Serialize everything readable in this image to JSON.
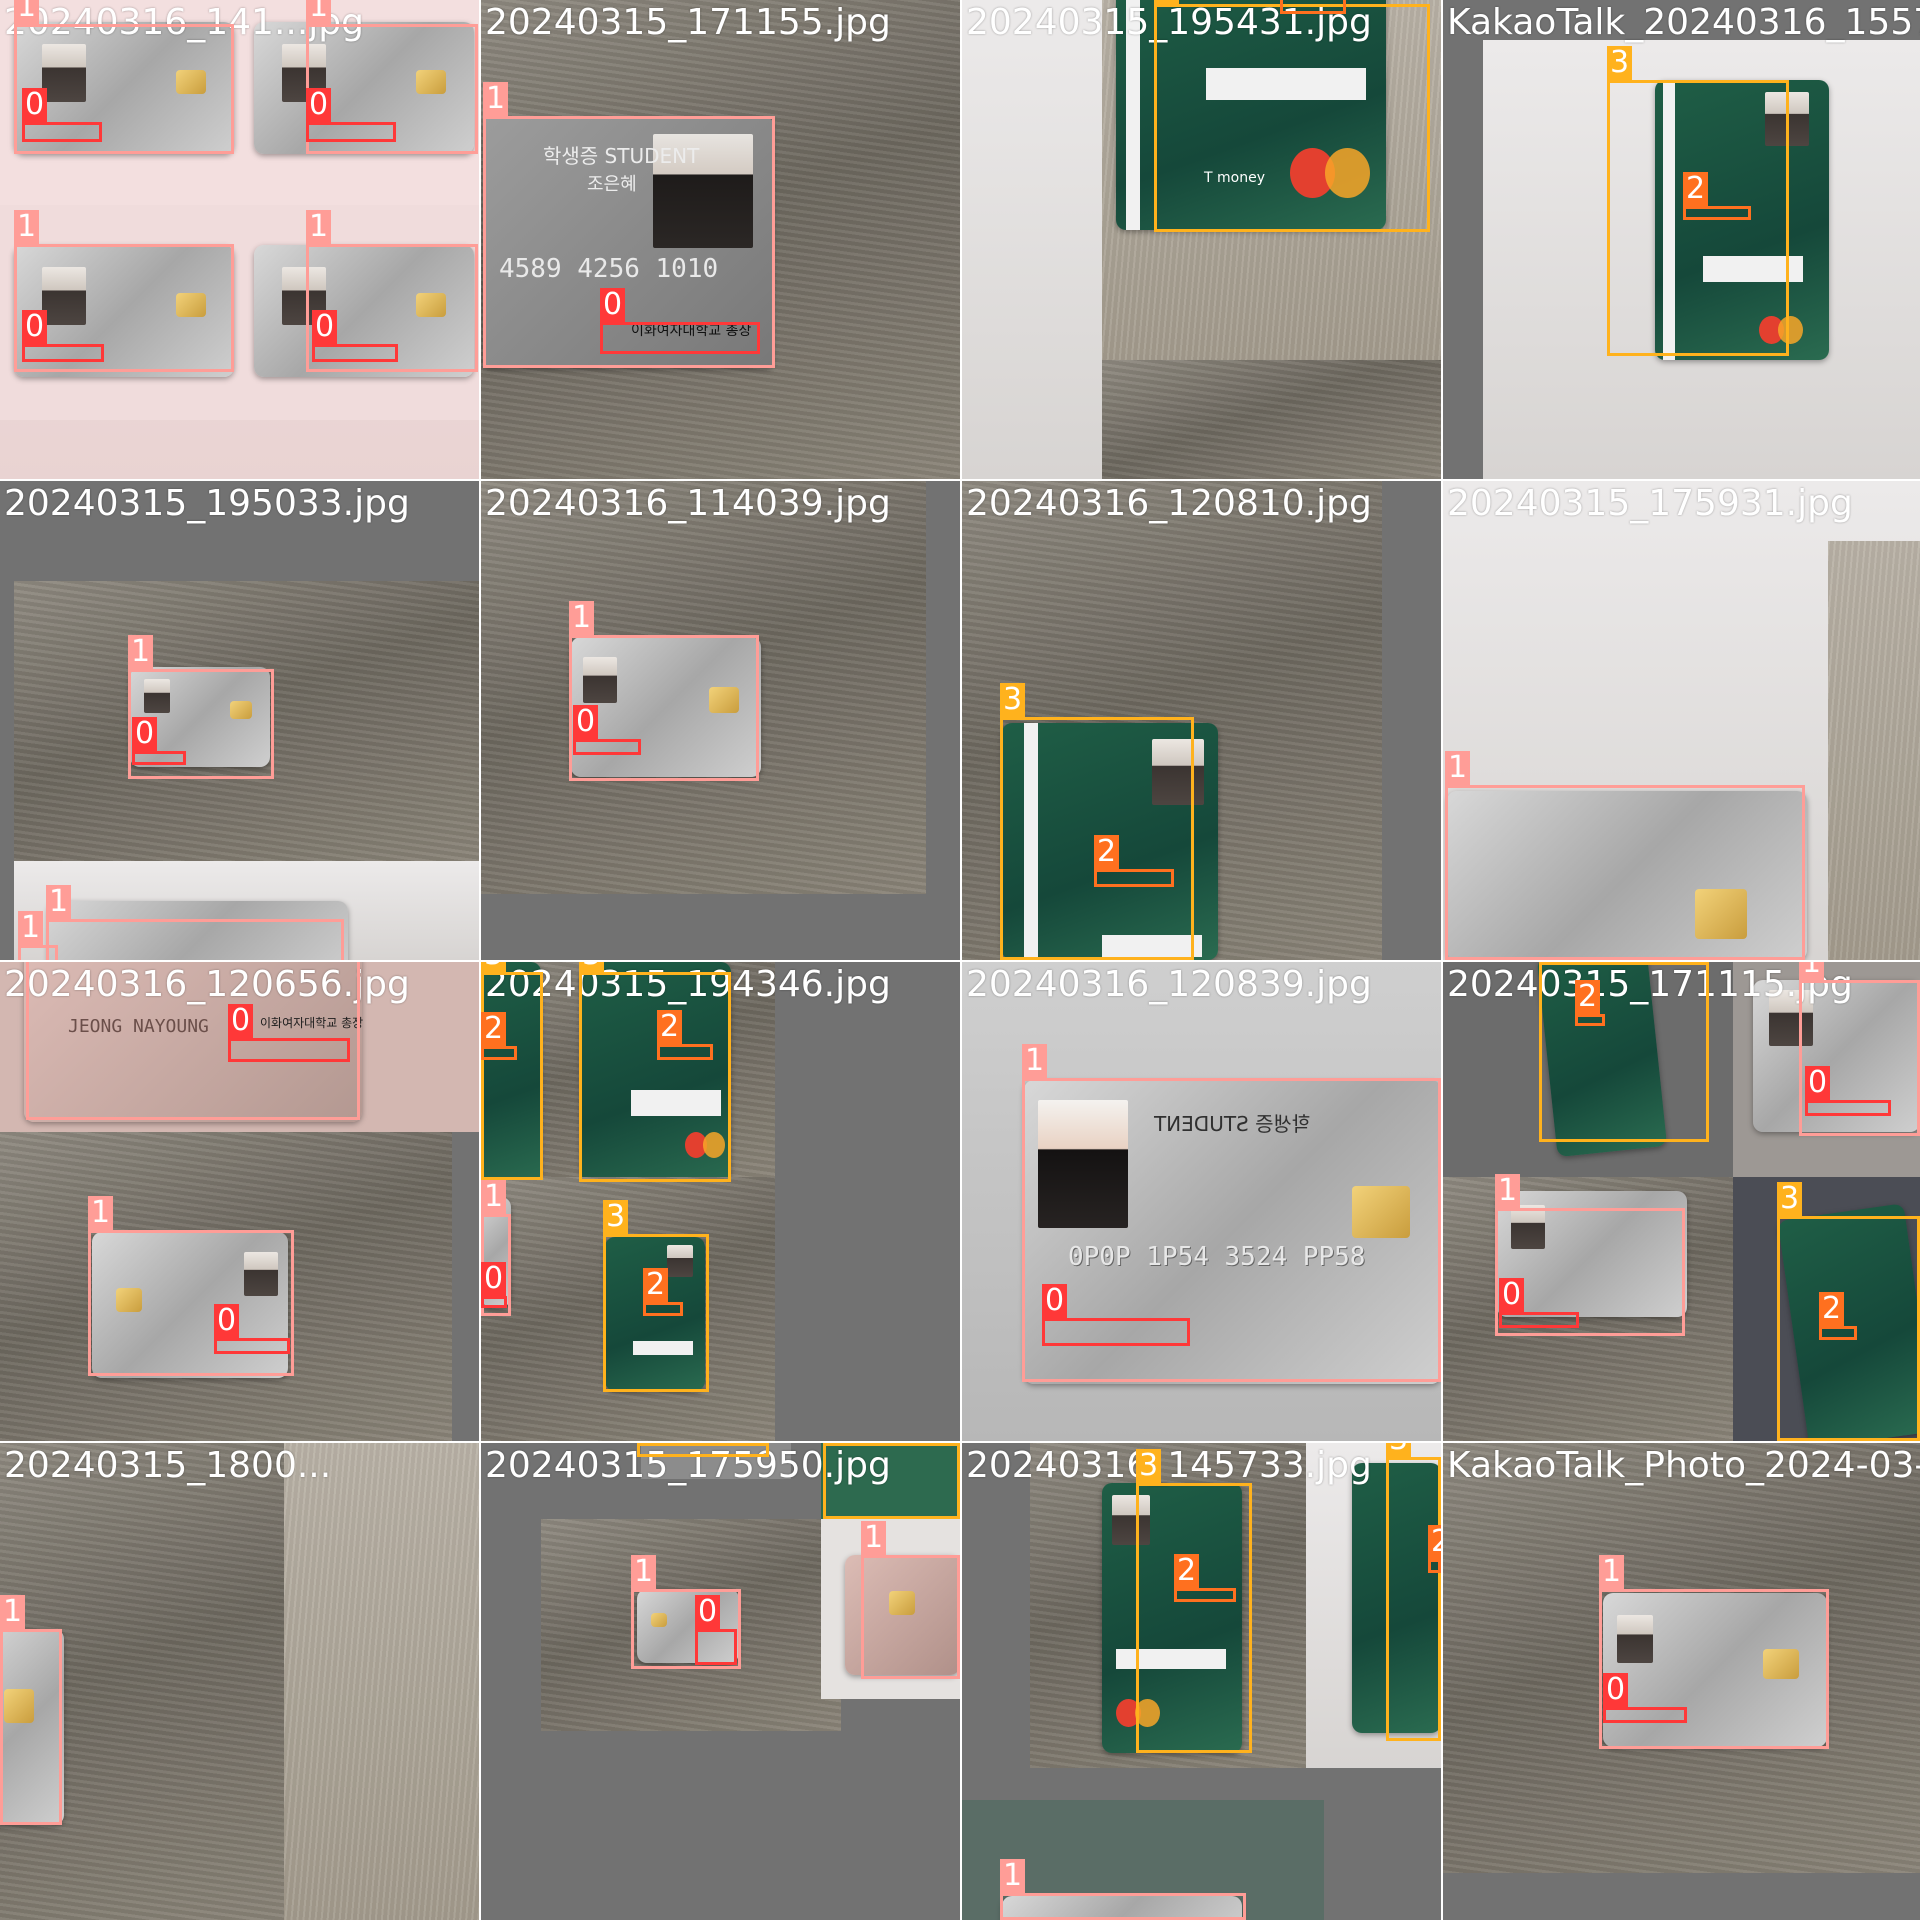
{
  "mosaic": {
    "tiles": [
      {
        "id": "t00",
        "filename": "20240316_141...jpg"
      },
      {
        "id": "t01",
        "filename": "20240315_171155.jpg"
      },
      {
        "id": "t02",
        "filename": "20240315_195431.jpg"
      },
      {
        "id": "t03",
        "filename": "KakaoTalk_20240316_1557"
      },
      {
        "id": "t10",
        "filename": "20240315_195033.jpg"
      },
      {
        "id": "t11",
        "filename": "20240316_114039.jpg"
      },
      {
        "id": "t12",
        "filename": "20240316_120810.jpg"
      },
      {
        "id": "t13",
        "filename": "20240315_175931.jpg"
      },
      {
        "id": "t20",
        "filename": "20240316_120656.jpg"
      },
      {
        "id": "t21",
        "filename": "20240315_194346.jpg"
      },
      {
        "id": "t22",
        "filename": "20240316_120839.jpg"
      },
      {
        "id": "t23",
        "filename": "20240315_171115.jpg"
      },
      {
        "id": "t30",
        "filename": "20240315_1800..."
      },
      {
        "id": "t31",
        "filename": "20240315_175950.jpg"
      },
      {
        "id": "t32",
        "filename": "20240316_145733.jpg"
      },
      {
        "id": "t33",
        "filename": "KakaoTalk_Photo_2024-03-"
      }
    ],
    "class_labels": {
      "c0": "0",
      "c1": "1",
      "c2": "2",
      "c3": "3"
    },
    "class_colors": {
      "c0": "#ff3838",
      "c1": "#ff9d97",
      "c2": "#ff701f",
      "c3": "#ffb21d"
    },
    "card_text": {
      "student_en": "학생증 STUDENT",
      "student_name": "조은혜",
      "student_no": "4589 4256 1010",
      "univ_seal": "이화여자대학교 총장",
      "holder": "JEONG NAYOUNG",
      "card_no": "0P0P 1P54 3524 PP58",
      "brand": "T money"
    }
  }
}
